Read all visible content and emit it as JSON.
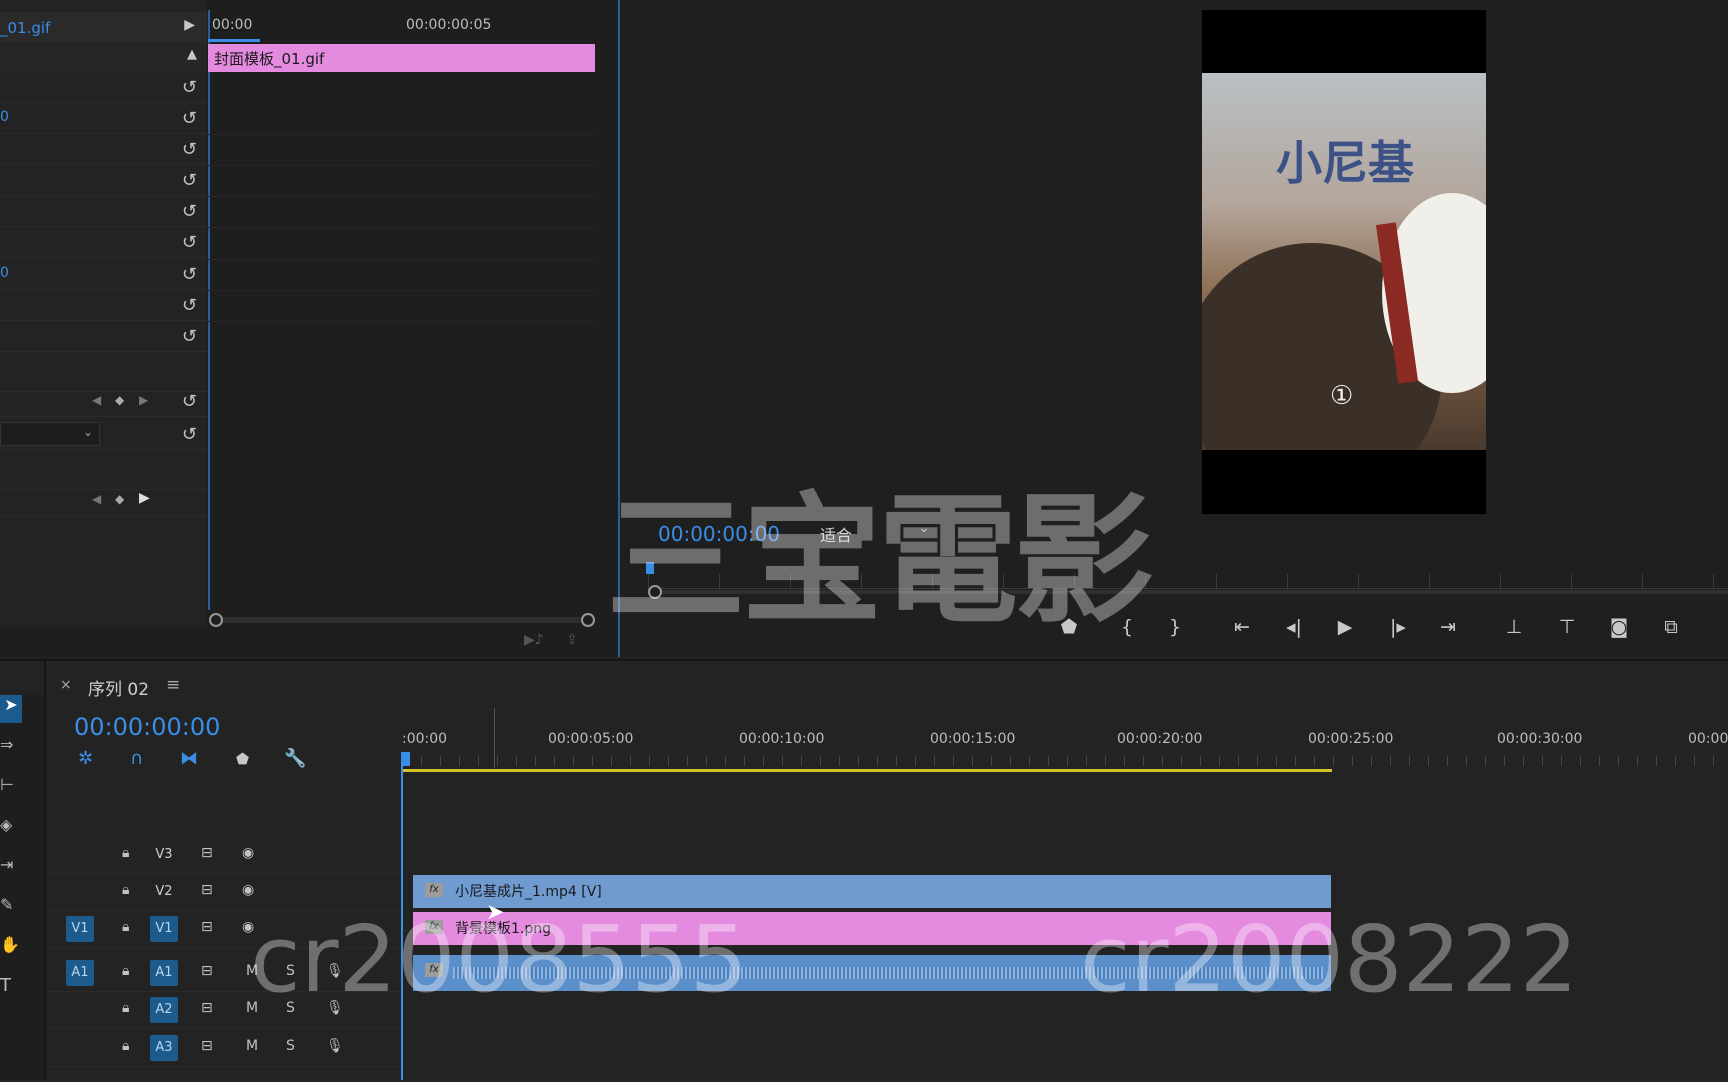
{
  "effect_controls": {
    "clip_name": "_01.gif",
    "ruler_start": "00:00",
    "ruler_mid": "00:00:00:05",
    "clip_bar_label": "封面模板_01.gif",
    "values": [
      "0",
      "0"
    ],
    "dropdown_value": ""
  },
  "monitor": {
    "timecode": "00:00:00:00",
    "fit_label": "适合",
    "title_text": "小尼基",
    "badge": "①"
  },
  "sequence": {
    "close": "×",
    "name": "序列 02",
    "menu": "≡",
    "timecode": "00:00:00:00",
    "ruler": [
      ":00:00",
      "00:00:05:00",
      "00:00:10:00",
      "00:00:15:00",
      "00:00:20:00",
      "00:00:25:00",
      "00:00:30:00",
      "00:00"
    ],
    "tracks": {
      "v3": "V3",
      "v2": "V2",
      "v1": "V1",
      "v1_src": "V1",
      "a1": "A1",
      "a1_src": "A1",
      "a2": "A2",
      "a3": "A3",
      "mute": "M",
      "solo": "S"
    },
    "clips": {
      "video_top": "小尼基成片_1.mp4 [V]",
      "video_bottom": "背景模板1.png",
      "fx": "fx"
    }
  },
  "watermarks": [
    "三宝電影",
    "cr2008555",
    "cr2008222"
  ],
  "colors": {
    "accent_blue": "#3a8ee6",
    "clip_pink": "#e48be0",
    "clip_blue": "#6f9bd1",
    "audio_clip": "#5b8fc9",
    "work_area": "#d4c228"
  }
}
